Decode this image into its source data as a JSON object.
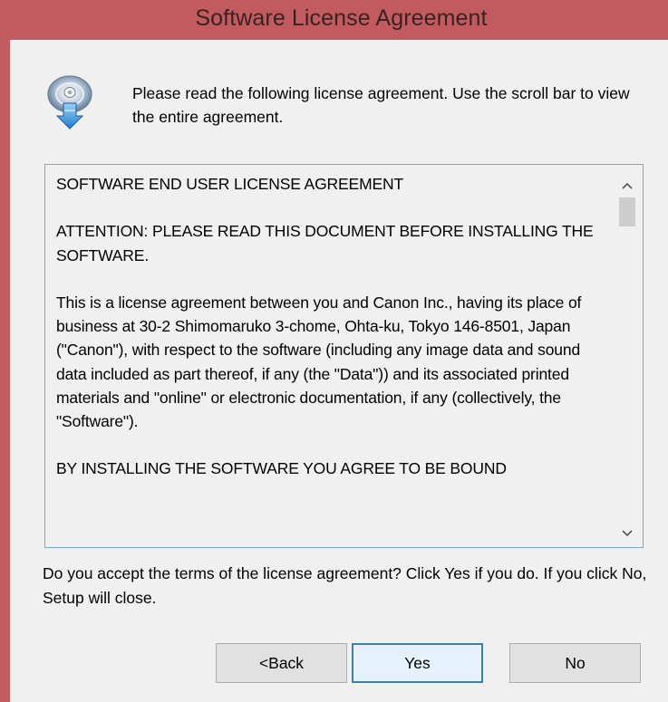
{
  "window": {
    "title": "Software License Agreement",
    "accent_color": "#c25b5f"
  },
  "header": {
    "icon": "install-disc-icon",
    "instruction": "Please read the following license agreement. Use the scroll bar to view the entire agreement."
  },
  "license": {
    "paragraphs": [
      "SOFTWARE END USER LICENSE AGREEMENT",
      "ATTENTION: PLEASE READ THIS DOCUMENT BEFORE INSTALLING THE SOFTWARE.",
      "This is a license agreement between you and Canon Inc., having its place of business at 30-2 Shimomaruko 3-chome, Ohta-ku, Tokyo 146-8501, Japan (\"Canon\"), with respect to the software (including any image data and sound data included as part thereof, if any (the \"Data\")) and its associated printed materials and \"online\" or electronic documentation, if any (collectively, the \"Software\").",
      "BY INSTALLING THE SOFTWARE YOU AGREE TO BE BOUND"
    ],
    "scroll_up_icon": "chevron-up-icon",
    "scroll_down_icon": "chevron-down-icon"
  },
  "prompt": {
    "question": "Do you accept the terms of the license agreement? Click Yes if you do. If you click No, Setup will close."
  },
  "buttons": {
    "back_label": "<Back",
    "yes_label": "Yes",
    "no_label": "No"
  }
}
